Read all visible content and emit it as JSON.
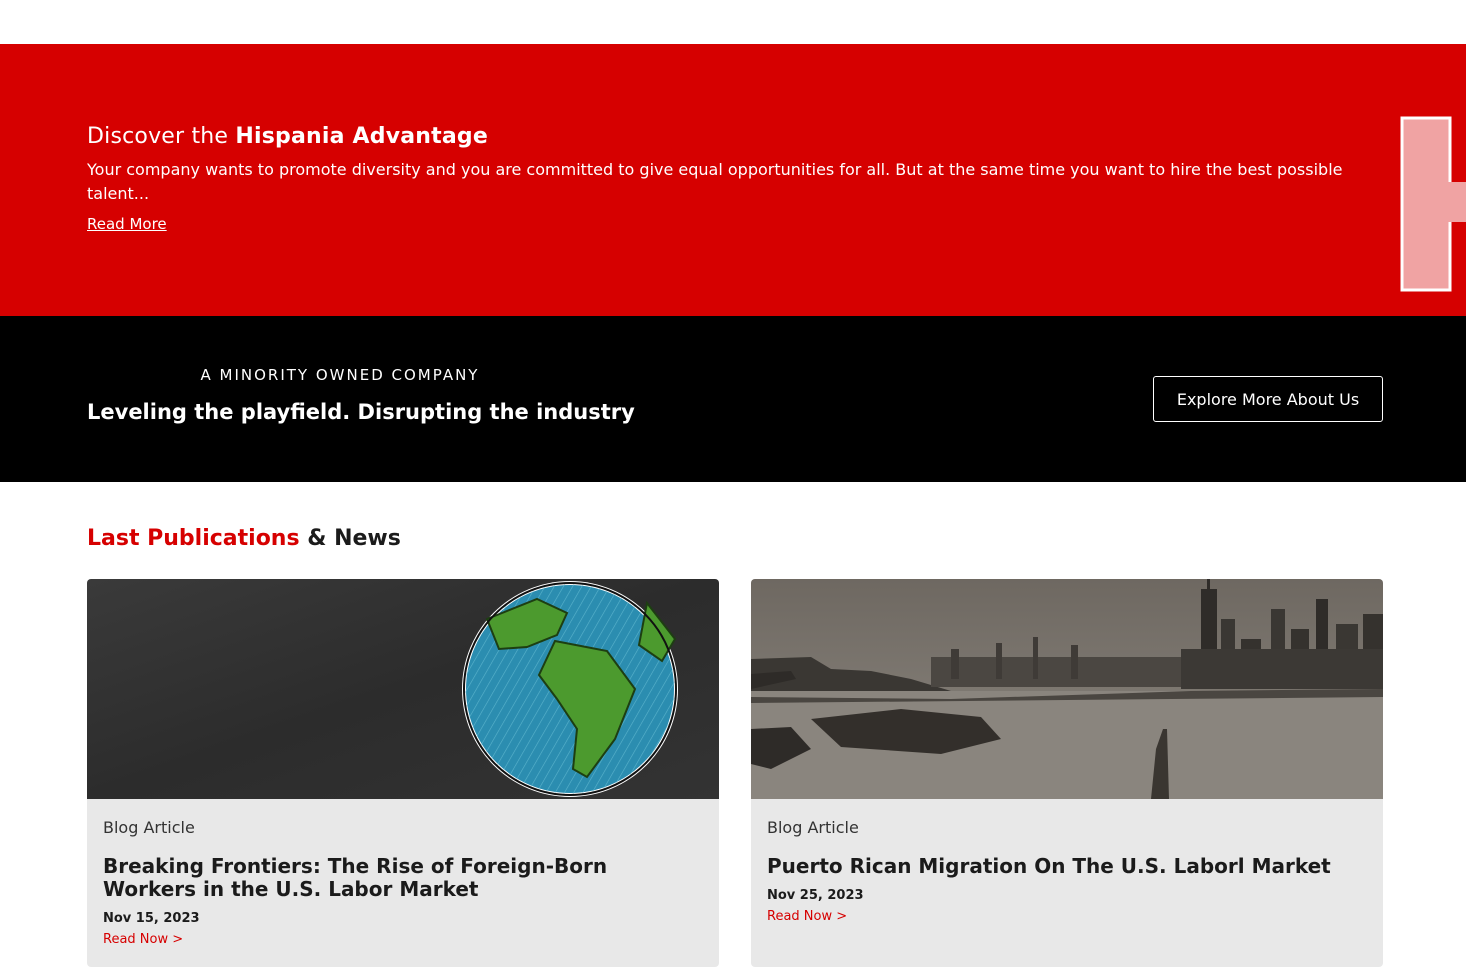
{
  "hero": {
    "title_regular": "Discover the ",
    "title_bold": "Hispania Advantage",
    "text": "Your company wants to promote diversity and you are committed to give equal opportunities for all. But at the same time you want to hire the best possible talent...",
    "link_label": "Read More",
    "bg_color": "#d60000"
  },
  "band": {
    "eyebrow": "A MINORITY OWNED COMPANY",
    "heading": "Leveling the playfield. Disrupting the industry",
    "button_label": "Explore More About Us"
  },
  "news": {
    "title_accent": "Last Publications",
    "title_rest": " & News",
    "cards": [
      {
        "category": "Blog Article",
        "title_bold": "Breaking Frontiers:",
        "title_rest": " The Rise of Foreign-Born Workers in the U.S. Labor Market",
        "date": "Nov 15, 2023",
        "read_label": "Read Now >",
        "image": "globe-on-chalkboard-image"
      },
      {
        "category": "Blog Article",
        "title_bold": "Puerto Rican Migration",
        "title_rest": " On The U.S. Laborl Market",
        "date": "Nov 25, 2023",
        "read_label": "Read Now >",
        "image": "new-york-skyline-image"
      }
    ]
  },
  "colors": {
    "accent": "#d60000",
    "dark": "#000000",
    "card_bg": "#e8e8e8"
  }
}
